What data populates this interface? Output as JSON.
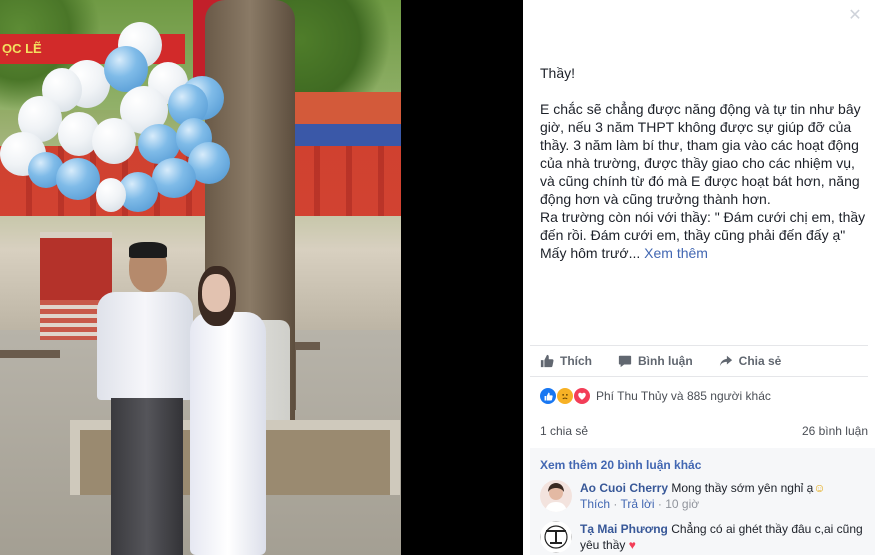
{
  "photo": {
    "sign_text": "ỌC LẼ"
  },
  "post": {
    "paragraphs": [
      "Thầy!",
      "E chắc sẽ chẳng được năng động và tự tin như bây giờ, nếu 3 năm THPT không được sự giúp đỡ của thầy. 3 năm làm bí thư, tham gia vào các hoạt động của nhà trường, được thầy giao cho các nhiệm vụ, và cũng chính từ đó mà E được hoạt bát hơn, năng động hơn và cũng trưởng thành hơn.",
      "Ra trường còn nói với thầy: \" Đám cưới chị em, thầy đến rồi. Đám cưới em, thầy cũng phải đến đấy ạ\"",
      "Mấy hôm trướ..."
    ],
    "see_more": "Xem thêm"
  },
  "actions": {
    "like": "Thích",
    "comment": "Bình luận",
    "share": "Chia sẻ"
  },
  "reactions": {
    "summary": "Phí Thu Thủy và 885 người khác"
  },
  "stats": {
    "shares": "1 chia sẻ",
    "comments": "26 bình luận"
  },
  "comments": {
    "view_more": "Xem thêm 20 bình luận khác",
    "items": [
      {
        "author": "Ao Cuoi Cherry",
        "text": "Mong thầy sớm yên nghỉ ạ",
        "emoji": "☺",
        "like_label": "Thích",
        "reply_label": "Trả lời",
        "time": "10 giờ"
      },
      {
        "author": "Tạ Mai Phương",
        "text": "Chẳng có ai ghét thầy đâu c,ai cũng yêu thầy",
        "emoji": "♥"
      }
    ]
  },
  "colors": {
    "link": "#4267b2",
    "author": "#385898",
    "like_blue": "#1877f2",
    "love_red": "#f33e58",
    "sad_yellow": "#f7b125"
  }
}
